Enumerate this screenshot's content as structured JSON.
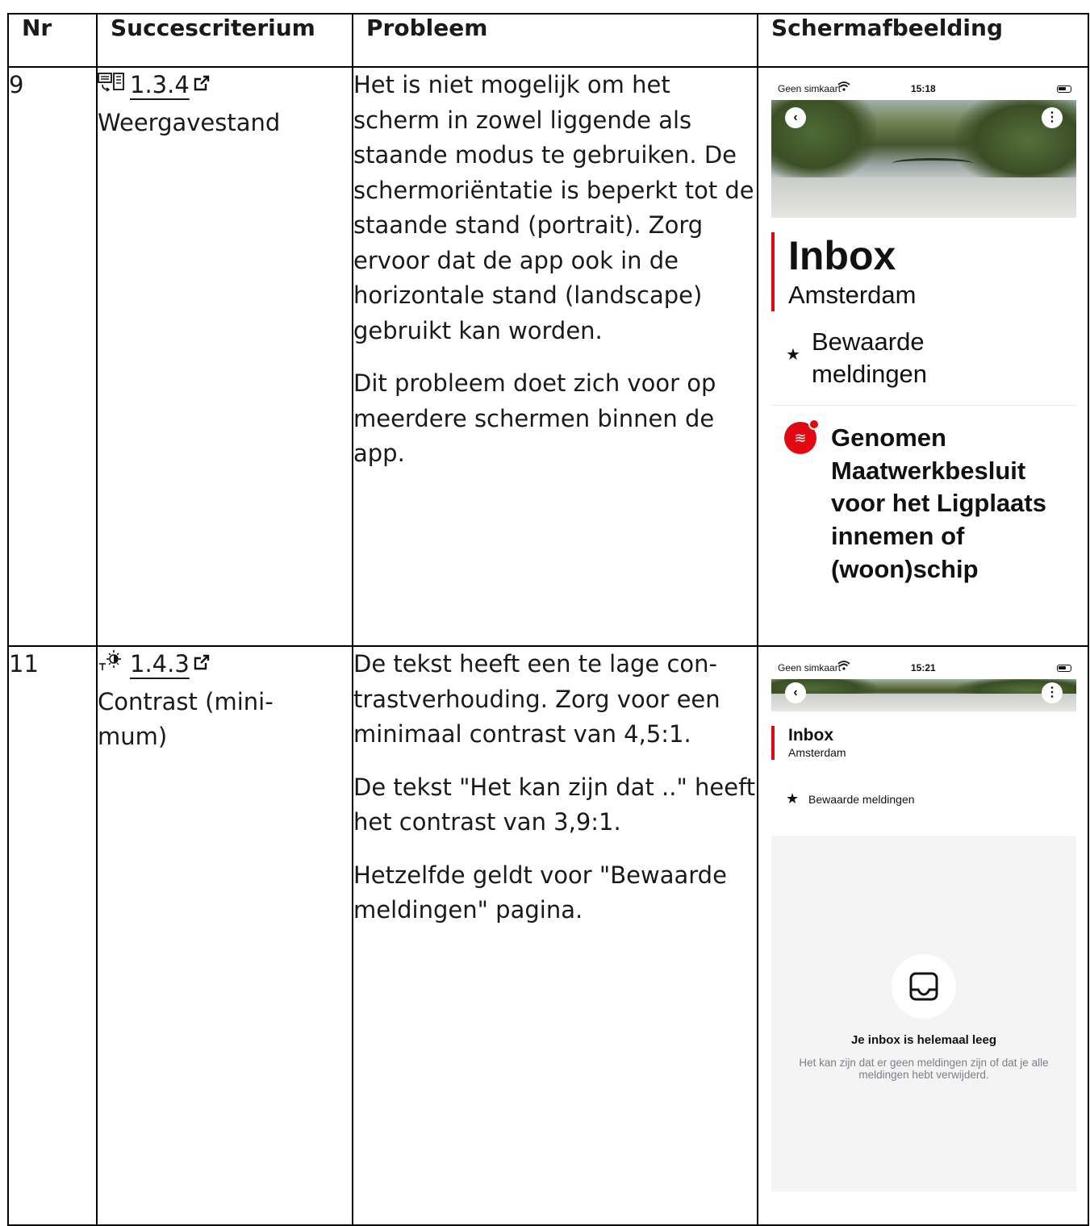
{
  "table": {
    "headers": {
      "nr": "Nr",
      "criterion": "Succescriterium",
      "problem": "Probleem",
      "screenshot": "Schermafbeelding"
    },
    "rows": [
      {
        "nr": "9",
        "criterion_icon": "orientation-icon",
        "criterion_code": "1.3.4",
        "criterion_name": "Weergavestand",
        "problem": [
          "Het is niet mogelijk om het scherm in zowel liggende als staande modus te gebruiken. De schermoriëntatie is beperkt tot de staande stand (portrait). Zorg ervoor dat de app ook in de horizontale stand (land­scape) gebruikt kan worden.",
          "Dit probleem doet zich voor op meerdere schermen binnen de app."
        ],
        "screenshot": {
          "carrier": "Geen simkaart",
          "time": "15:18",
          "title": "Inbox",
          "city": "Amsterdam",
          "saved": "Bewaarde meldingen",
          "notification_title": "Genomen Maatwerkbesluit voor het Ligplaats innemen of (woon)schip"
        }
      },
      {
        "nr": "11",
        "criterion_icon": "contrast-icon",
        "criterion_code": "1.4.3",
        "criterion_name": "Contrast (mini­mum)",
        "problem": [
          "De tekst heeft een te lage con­trastverhouding. Zorg voor een minimaal contrast van 4,5:1.",
          "De tekst \"Het kan zijn dat ..\" heeft het contrast van 3,9:1.",
          "Hetzelfde geldt voor \"Be­waarde meldingen\" pagina."
        ],
        "screenshot": {
          "carrier": "Geen simkaart",
          "time": "15:21",
          "title": "Inbox",
          "city": "Amsterdam",
          "saved": "Bewaarde meldingen",
          "empty_title": "Je inbox is helemaal leeg",
          "empty_text": "Het kan zijn dat er geen meldingen zijn of dat je alle meldingen hebt verwijderd."
        }
      }
    ]
  },
  "colors": {
    "accent_red": "#e30613",
    "border": "#000000",
    "muted_text": "#7a7f86"
  }
}
